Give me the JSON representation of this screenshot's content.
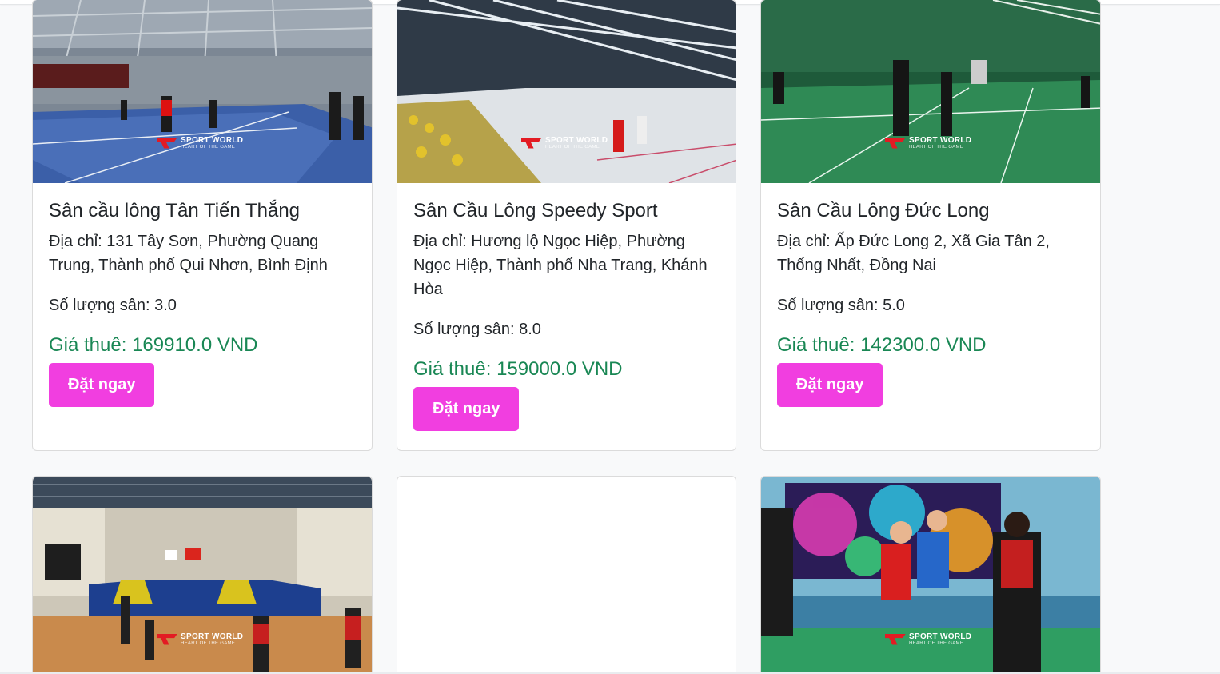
{
  "courts": [
    {
      "title": "Sân cầu lông Tân Tiến Thắng",
      "address": "Địa chỉ: 131 Tây Sơn, Phường Quang Trung, Thành phố Qui Nhơn, Bình Định",
      "quantity": "Số lượng sân: 3.0",
      "price": "Giá thuê: 169910.0 VND",
      "button": "Đặt ngay",
      "image": "indoor-badminton-hall-blue-court"
    },
    {
      "title": "Sân Cầu Lông Speedy Sport",
      "address": "Địa chỉ: Hương lộ Ngọc Hiệp, Phường Ngọc Hiệp, Thành phố Nha Trang, Khánh Hòa",
      "quantity": "Số lượng sân: 8.0",
      "price": "Giá thuê: 159000.0 VND",
      "button": "Đặt ngay",
      "image": "large-badminton-hall-crowd"
    },
    {
      "title": "Sân Cầu Lông Đức Long",
      "address": "Địa chỉ: Ấp Đức Long 2, Xã Gia Tân 2, Thống Nhất, Đồng Nai",
      "quantity": "Số lượng sân: 5.0",
      "price": "Giá thuê: 142300.0 VND",
      "button": "Đặt ngay",
      "image": "green-badminton-court-players"
    }
  ],
  "row2_images": [
    "sports-arena-stands",
    "blank",
    "tournament-doubles-match"
  ],
  "watermark": {
    "brand": "SPORT WORLD",
    "tagline": "HEART OF THE GAME"
  },
  "colors": {
    "button": "#f13ee0",
    "price": "#198754",
    "background": "#f8f9fa"
  }
}
